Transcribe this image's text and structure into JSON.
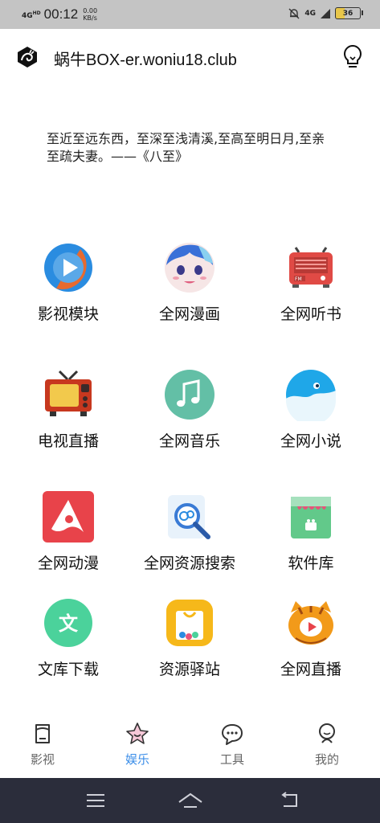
{
  "status_bar": {
    "signal": "4G",
    "hd": "HD",
    "time": "00:12",
    "speed_value": "0.00",
    "speed_unit": "KB/s",
    "network": "4G",
    "battery": "36"
  },
  "header": {
    "title": "蜗牛BOX-er.woniu18.club",
    "logo_icon": "snail-logo-icon",
    "action_icon": "lightbulb-icon"
  },
  "quote": "至近至远东西，至深至浅清溪,至高至明日月,至亲至疏夫妻。——《八至》",
  "grid": [
    {
      "label": "影视模块",
      "icon": "play-circle-icon"
    },
    {
      "label": "全网漫画",
      "icon": "anime-avatar-icon"
    },
    {
      "label": "全网听书",
      "icon": "radio-icon"
    },
    {
      "label": "电视直播",
      "icon": "tv-icon"
    },
    {
      "label": "全网音乐",
      "icon": "music-note-icon"
    },
    {
      "label": "全网小说",
      "icon": "whale-icon"
    },
    {
      "label": "全网动漫",
      "icon": "adobe-air-icon"
    },
    {
      "label": "全网资源搜索",
      "icon": "magnifier-search-icon"
    },
    {
      "label": "软件库",
      "icon": "android-bag-icon"
    },
    {
      "label": "文库下载",
      "icon": "document-text-icon"
    },
    {
      "label": "资源驿站",
      "icon": "shopping-bag-icon"
    },
    {
      "label": "全网直播",
      "icon": "tiger-live-icon"
    }
  ],
  "bottom_nav": [
    {
      "label": "影视",
      "icon": "bookmark-icon",
      "active": false
    },
    {
      "label": "娱乐",
      "icon": "star-icon",
      "active": true
    },
    {
      "label": "工具",
      "icon": "chat-bubble-icon",
      "active": false
    },
    {
      "label": "我的",
      "icon": "person-icon",
      "active": false
    }
  ],
  "colors": {
    "accent": "#3a8de8",
    "status_bar": "#c4c4c4",
    "system_nav": "#2b2d3b"
  }
}
